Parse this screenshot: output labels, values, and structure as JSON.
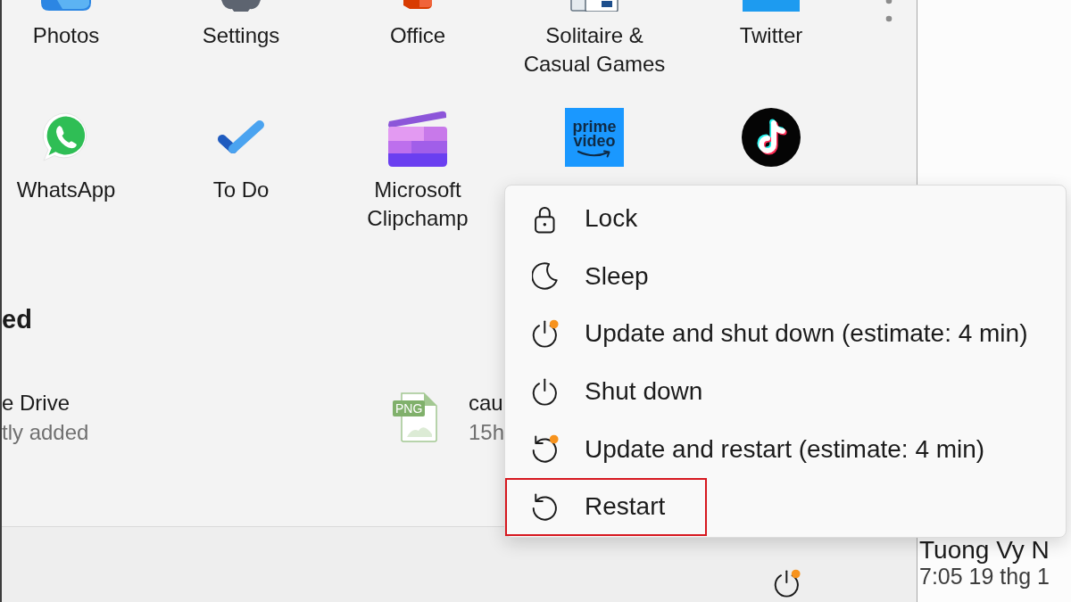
{
  "start_menu": {
    "pinned_apps": [
      {
        "label": "Photos",
        "kind": "photo"
      },
      {
        "label": "Settings",
        "kind": "gear"
      },
      {
        "label": "Office",
        "kind": "office"
      },
      {
        "label": "Solitaire & Casual Games",
        "kind": "cards"
      },
      {
        "label": "Twitter",
        "kind": "bird"
      },
      {
        "label": "WhatsApp",
        "kind": "chat"
      },
      {
        "label": "To Do",
        "kind": "check"
      },
      {
        "label": "Microsoft Clipchamp",
        "kind": "clapper"
      },
      {
        "kind": "video",
        "logo_text": [
          "prime",
          "video"
        ]
      },
      {
        "kind": "note"
      }
    ],
    "recommended": {
      "heading": "ed",
      "items": [
        {
          "title": "e Drive",
          "subtitle": "tly added"
        },
        {
          "title": "cau",
          "subtitle": "15h",
          "file_type": "PNG"
        }
      ]
    },
    "power_button": {
      "update_badge": true
    }
  },
  "power_menu": {
    "items": [
      {
        "label": "Lock",
        "kind": "lock",
        "update_badge": false,
        "highlighted": false
      },
      {
        "label": "Sleep",
        "kind": "sleep",
        "update_badge": false,
        "highlighted": false
      },
      {
        "label": "Update and shut down (estimate: 4 min)",
        "kind": "power",
        "update_badge": true,
        "highlighted": false
      },
      {
        "label": "Shut down",
        "kind": "power",
        "update_badge": false,
        "highlighted": false
      },
      {
        "label": "Update and restart (estimate: 4 min)",
        "kind": "restart",
        "update_badge": true,
        "highlighted": false
      },
      {
        "label": "Restart",
        "kind": "restart",
        "update_badge": false,
        "highlighted": true
      }
    ]
  },
  "side_panel": {
    "name": "Tuong Vy N",
    "time": "7:05 19 thg 1"
  }
}
